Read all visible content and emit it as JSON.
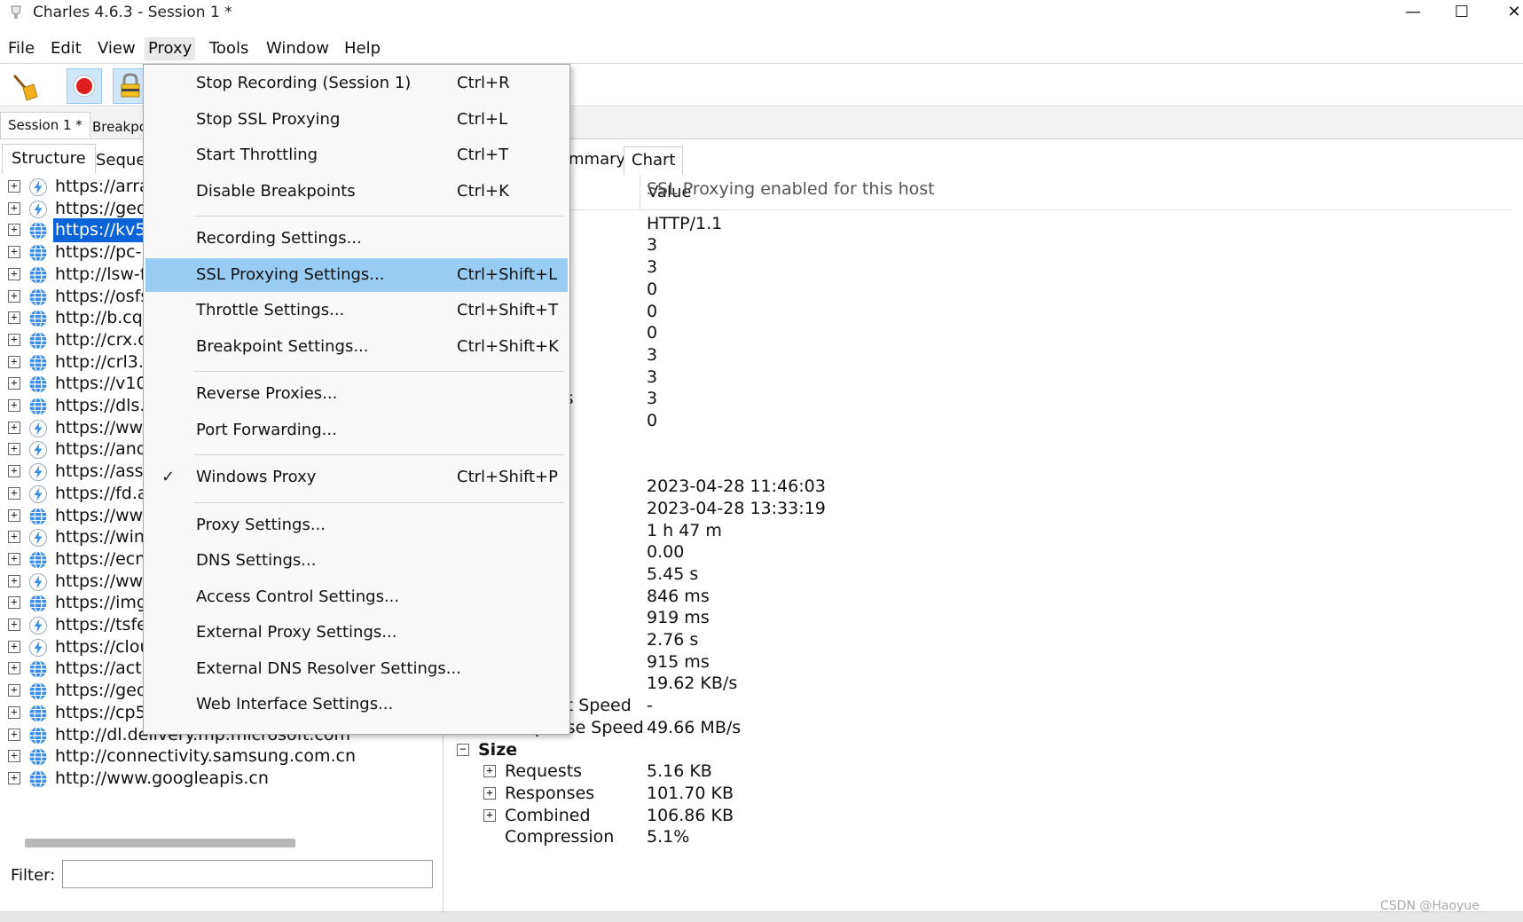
{
  "window": {
    "title": "Charles 4.6.3 - Session 1 *",
    "minimize_glyph": "—",
    "maximize_glyph": "☐",
    "close_glyph": "✕"
  },
  "menubar": {
    "items": [
      {
        "label": "File"
      },
      {
        "label": "Edit"
      },
      {
        "label": "View"
      },
      {
        "label": "Proxy",
        "active": true
      },
      {
        "label": "Tools"
      },
      {
        "label": "Window"
      },
      {
        "label": "Help"
      }
    ]
  },
  "toolbar": {
    "icons": [
      "broom-icon",
      "record-icon",
      "ssl-lock-icon"
    ],
    "accent": "#e02020"
  },
  "session_tabs": [
    {
      "label": "Session 1 *"
    },
    {
      "label": "Breakpo"
    }
  ],
  "view_tabs": [
    {
      "label": "Structure"
    },
    {
      "label": "Seque"
    }
  ],
  "tree": {
    "items": [
      {
        "host": "https://arra",
        "icon": "lightning-icon"
      },
      {
        "host": "https://geo",
        "icon": "lightning-icon"
      },
      {
        "host": "https://kv5",
        "icon": "globe-icon",
        "selected": true
      },
      {
        "host": "https://pc-",
        "icon": "globe-icon"
      },
      {
        "host": "http://lsw-f",
        "icon": "globe-icon"
      },
      {
        "host": "https://osfs",
        "icon": "globe-icon"
      },
      {
        "host": "http://b.cq",
        "icon": "globe-icon"
      },
      {
        "host": "http://crx.c",
        "icon": "globe-icon"
      },
      {
        "host": "http://crl3.",
        "icon": "globe-icon"
      },
      {
        "host": "https://v10",
        "icon": "globe-icon"
      },
      {
        "host": "https://dls.",
        "icon": "globe-icon"
      },
      {
        "host": "https://ww",
        "icon": "lightning-icon"
      },
      {
        "host": "https://and",
        "icon": "lightning-icon"
      },
      {
        "host": "https://asse",
        "icon": "lightning-icon"
      },
      {
        "host": "https://fd.a",
        "icon": "lightning-icon"
      },
      {
        "host": "https://ww",
        "icon": "globe-icon"
      },
      {
        "host": "https://win",
        "icon": "lightning-icon"
      },
      {
        "host": "https://ecn.",
        "icon": "globe-icon"
      },
      {
        "host": "https://ww",
        "icon": "lightning-icon"
      },
      {
        "host": "https://img",
        "icon": "globe-icon"
      },
      {
        "host": "https://tsfe",
        "icon": "lightning-icon"
      },
      {
        "host": "https://clou",
        "icon": "lightning-icon"
      },
      {
        "host": "https://acti",
        "icon": "globe-icon"
      },
      {
        "host": "https://geover.prod.do.dsp.mp.microsoft.com",
        "icon": "globe-icon"
      },
      {
        "host": "https://cp501.prod.do.dsp.mp.microsoft.com",
        "icon": "globe-icon"
      },
      {
        "host": "http://dl.delivery.mp.microsoft.com",
        "icon": "globe-icon"
      },
      {
        "host": "http://connectivity.samsung.com.cn",
        "icon": "globe-icon"
      },
      {
        "host": "http://www.googleapis.cn",
        "icon": "globe-icon"
      }
    ]
  },
  "filter": {
    "label": "Filter:",
    "value": ""
  },
  "detail_tabs": [
    {
      "label": "mmary"
    },
    {
      "label": "Chart"
    }
  ],
  "detail_columns": {
    "value": "Value"
  },
  "detail_rows": [
    {
      "name": "",
      "value": "SSL Proxying enabled for this host"
    },
    {
      "name": "",
      "value": "HTTP/1.1"
    },
    {
      "name": "",
      "value": "3"
    },
    {
      "name": "ed",
      "value": "3"
    },
    {
      "name": "ete",
      "value": "0"
    },
    {
      "name": "",
      "value": "0"
    },
    {
      "name": "",
      "value": "0"
    },
    {
      "name": "",
      "value": "3"
    },
    {
      "name": "s",
      "value": "3"
    },
    {
      "name": "dshakes",
      "value": "3"
    },
    {
      "name": "e",
      "value": "0"
    },
    {
      "name": "",
      "value": ""
    },
    {
      "name": "",
      "value": "2023-04-28 11:46:03"
    },
    {
      "name": "",
      "value": "2023-04-28 13:33:19"
    },
    {
      "name": "n",
      "value": "1 h 47 m"
    },
    {
      "name": "s / sec",
      "value": "0.00"
    },
    {
      "name": "",
      "value": "5.45 s"
    },
    {
      "name": "",
      "value": "846 ms"
    },
    {
      "name": "",
      "value": "919 ms"
    },
    {
      "name": "dshake",
      "value": "2.76 s"
    },
    {
      "name": "",
      "value": "915 ms"
    },
    {
      "name": "",
      "value": "19.62 KB/s"
    },
    {
      "name": "Request Speed",
      "value": "-",
      "expandable": true
    },
    {
      "name": "Response Speed",
      "value": "49.66 MB/s",
      "expandable": true
    },
    {
      "name": "Size",
      "value": "",
      "group": true
    },
    {
      "name": "Requests",
      "value": "5.16 KB",
      "expandable": true
    },
    {
      "name": "Responses",
      "value": "101.70 KB",
      "expandable": true
    },
    {
      "name": "Combined",
      "value": "106.86 KB",
      "expandable": true
    },
    {
      "name": "Compression",
      "value": "5.1%"
    }
  ],
  "proxy_menu": {
    "items": [
      {
        "label": "Stop Recording (Session 1)",
        "shortcut": "Ctrl+R"
      },
      {
        "label": "Stop SSL Proxying",
        "shortcut": "Ctrl+L"
      },
      {
        "label": "Start Throttling",
        "shortcut": "Ctrl+T"
      },
      {
        "label": "Disable Breakpoints",
        "shortcut": "Ctrl+K"
      },
      {
        "separator": true
      },
      {
        "label": "Recording Settings...",
        "shortcut": ""
      },
      {
        "label": "SSL Proxying Settings...",
        "shortcut": "Ctrl+Shift+L",
        "highlight": true
      },
      {
        "label": "Throttle Settings...",
        "shortcut": "Ctrl+Shift+T"
      },
      {
        "label": "Breakpoint Settings...",
        "shortcut": "Ctrl+Shift+K"
      },
      {
        "separator": true
      },
      {
        "label": "Reverse Proxies...",
        "shortcut": ""
      },
      {
        "label": "Port Forwarding...",
        "shortcut": ""
      },
      {
        "separator": true
      },
      {
        "label": "Windows Proxy",
        "shortcut": "Ctrl+Shift+P",
        "checked": true
      },
      {
        "separator": true
      },
      {
        "label": "Proxy Settings...",
        "shortcut": ""
      },
      {
        "label": "DNS Settings...",
        "shortcut": ""
      },
      {
        "label": "Access Control Settings...",
        "shortcut": ""
      },
      {
        "label": "External Proxy Settings...",
        "shortcut": ""
      },
      {
        "label": "External DNS Resolver Settings...",
        "shortcut": ""
      },
      {
        "label": "Web Interface Settings...",
        "shortcut": ""
      }
    ],
    "checkmark": "✓"
  },
  "watermark": "CSDN @Haoyue",
  "colors": {
    "selection": "#0a64d8",
    "menu_highlight": "#99ccf3",
    "globe": "#3a8ee6"
  }
}
